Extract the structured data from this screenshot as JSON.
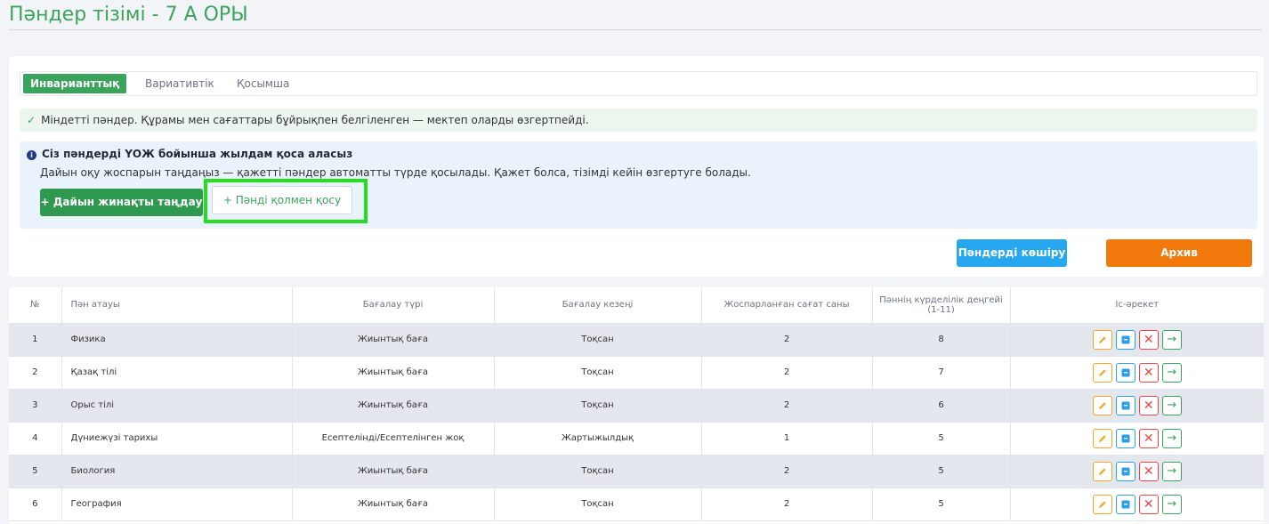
{
  "page": {
    "title": "Пәндер тізімі",
    "separator": "-",
    "class_name": "7 А ОРЫ"
  },
  "tabs": [
    {
      "label": "Инварианттық",
      "active": true
    },
    {
      "label": "Вариативтік",
      "active": false
    },
    {
      "label": "Қосымша",
      "active": false
    }
  ],
  "success_message": "Міндетті пәндер. Құрамы мен сағаттары бұйрықпен белгіленген — мектеп оларды өзгертпейді.",
  "info": {
    "title": "Сіз пәндерді ҮОЖ бойынша жылдам қоса аласыз",
    "description": "Дайын оқу жоспарын таңдаңыз — қажетті пәндер автоматты түрде қосылады. Қажет болса, тізімді кейін өзгертуге болады.",
    "ready_button": "+ Дайын жинақты таңдау",
    "manual_button": "+ Пәнді қолмен қосу"
  },
  "toolbar": {
    "copy_button": "Пәндерді көшіру",
    "archive_button": "Архив"
  },
  "table": {
    "headers": [
      "№",
      "Пән атауы",
      "Бағалау түрі",
      "Бағалау кезеңі",
      "Жоспарланған сағат саны",
      "Пәннің күрделілік деңгейі (1-11)",
      "Іс-әрекет"
    ],
    "rows": [
      [
        "1",
        "Физика",
        "Жиынтық баға",
        "Тоқсан",
        "2",
        "8"
      ],
      [
        "2",
        "Қазақ тілі",
        "Жиынтық баға",
        "Тоқсан",
        "2",
        "7"
      ],
      [
        "3",
        "Орыс тілі",
        "Жиынтық баға",
        "Тоқсан",
        "2",
        "6"
      ],
      [
        "4",
        "Дүниежүзі тарихы",
        "Есептелінді/Есептелінген жоқ",
        "Жартыжылдық",
        "1",
        "5"
      ],
      [
        "5",
        "Биология",
        "Жиынтық баға",
        "Тоқсан",
        "2",
        "5"
      ],
      [
        "6",
        "География",
        "Жиынтық баға",
        "Тоқсан",
        "2",
        "5"
      ]
    ]
  },
  "icons": {
    "edit": "pencil-icon",
    "archive": "archive-box-icon",
    "delete": "close-icon",
    "move": "arrow-right-icon"
  },
  "colors": {
    "accent_green": "#3aa45c",
    "highlight": "#22e01c",
    "copy_blue": "#27a7f0",
    "archive_orange": "#f27a0c"
  }
}
